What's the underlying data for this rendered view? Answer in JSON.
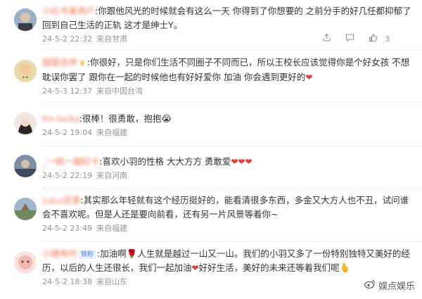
{
  "comments": [
    {
      "name": "小红书某用户",
      "sep": ":",
      "text": "你跟他风光的时候就会有这么一天 你得到了你想要的 之前分手的好几任都抑郁了 回到自己生活的正轨 这才是绅士Y。",
      "date": "24-5-2 22:32",
      "location": "来自甘肃",
      "likes": "3",
      "avatar_color": "#8aa0b8"
    },
    {
      "name": "甜甜吉祥",
      "sep": ":",
      "text": "你很好，只是你们生活不同圈子不同而已，所以王校长应该觉得你是个好女孩 不想耽误你罢了 跟你在一起的时候他也有好好爱你 加油 你会遇到更好的",
      "date": "24-5-3 12:37",
      "location": "来自中国台湾",
      "likes": "",
      "avatar_color": "#c9b27a"
    },
    {
      "name": "Irn-lucky",
      "sep": ":",
      "text": "很棒！很勇敢，抱抱😭",
      "date": "24-5-2 19:04",
      "location": "来自福建",
      "likes": "",
      "avatar_color": "#4b4644"
    },
    {
      "name": "_一统一越好卡",
      "sep": ":",
      "text": "喜欢小羽的性格 大大方方 勇敢爱",
      "date": "24-5-2 22:19",
      "location": "来自河南",
      "likes": "",
      "avatar_color": "#5a6f88"
    },
    {
      "name": "LuLu目录",
      "sep": ":",
      "text": "其实那么年轻就有这个经历挺好的，能看清很多东西，多金又大方人也不丑，试问谁会不喜欢呢。但是人还是要向前看，还有另一片风景等着你~",
      "date": "24-5-2 23:49",
      "location": "来自福建",
      "likes": "",
      "avatar_color": "#6f8a5c"
    },
    {
      "name": "小猪有时",
      "badge": "铁粉",
      "sep": ":",
      "text_a": "加油啊",
      "text_b": "人生就是越过一山又一山。我们的小羽又多了一份特别独特又美好的经历，以后的人生还很长，我们一起加油",
      "text_c": "好好生活，美好的未来还等着我们呢",
      "date": "24-5-2 18:38",
      "location": "来自山东",
      "likes": "",
      "avatar_color": "#e9c7c0"
    }
  ],
  "icons": {
    "share": "share-icon",
    "comment": "comment-icon",
    "like": "like-icon"
  },
  "watermark": "娱点娱乐"
}
